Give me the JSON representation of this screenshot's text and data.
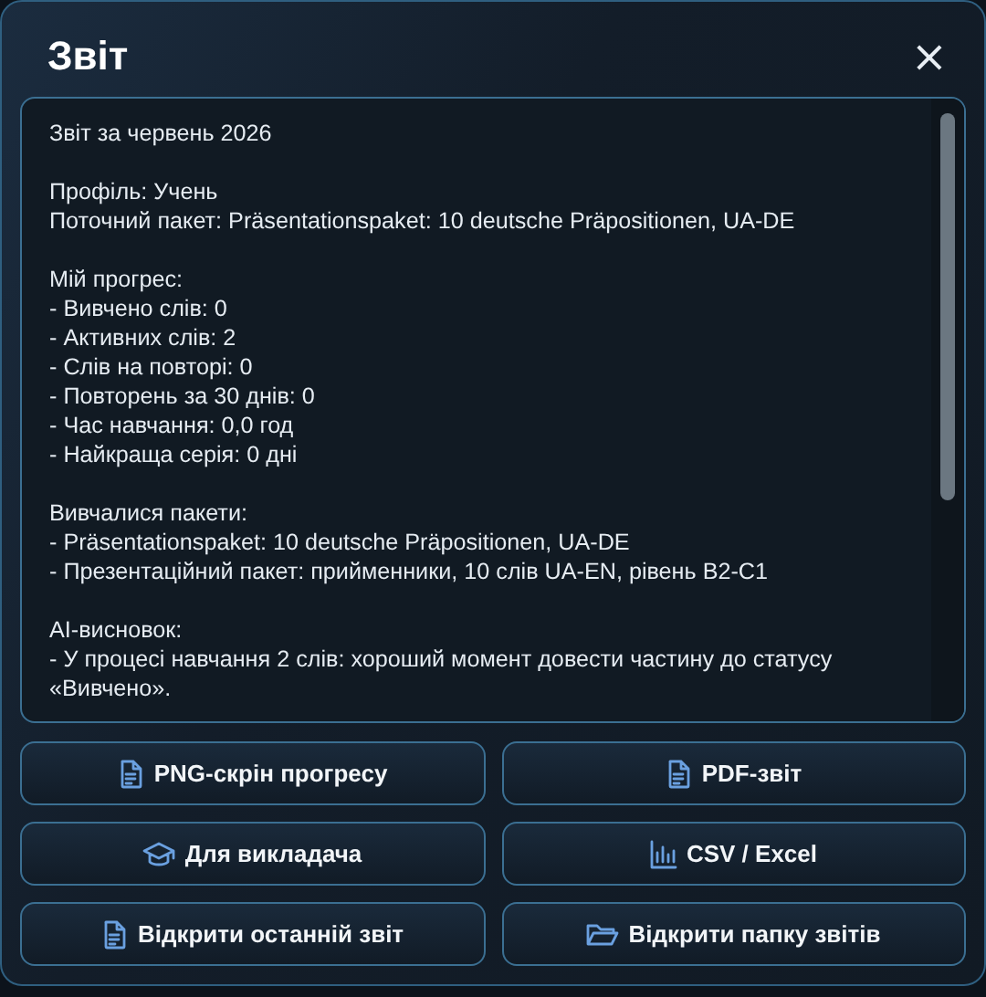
{
  "window": {
    "title": "Звіт",
    "close": "×"
  },
  "report": {
    "paragraphs": [
      [
        "Звіт за червень 2026"
      ],
      [
        "Профіль: Учень",
        "Поточний пакет: Präsentationspaket: 10 deutsche Präpositionen,  UA-DE"
      ],
      [
        "Мій прогрес:",
        "- Вивчено слів: 0",
        "- Активних слів: 2",
        "- Слів на повторі: 0",
        "- Повторень за 30 днів: 0",
        "- Час навчання: 0,0 год",
        "- Найкраща серія: 0 дні"
      ],
      [
        "Вивчалися пакети:",
        "- Präsentationspaket: 10 deutsche Präpositionen,  UA-DE",
        "- Презентаційний пакет: прийменники, 10 слів UA-EN, рівень B2-C1"
      ],
      [
        "AI-висновок:",
        "- У процесі навчання 2 слів: хороший момент довести частину до статусу «Вивчено»."
      ]
    ]
  },
  "buttons": [
    {
      "label": "PNG-скрін прогресу",
      "kind": "document"
    },
    {
      "label": "PDF-звіт",
      "kind": "document"
    },
    {
      "label": "Для викладача",
      "kind": "cap"
    },
    {
      "label": "CSV / Excel",
      "kind": "chart"
    },
    {
      "label": "Відкрити останній звіт",
      "kind": "document"
    },
    {
      "label": "Відкрити папку звітів",
      "kind": "folder"
    }
  ]
}
